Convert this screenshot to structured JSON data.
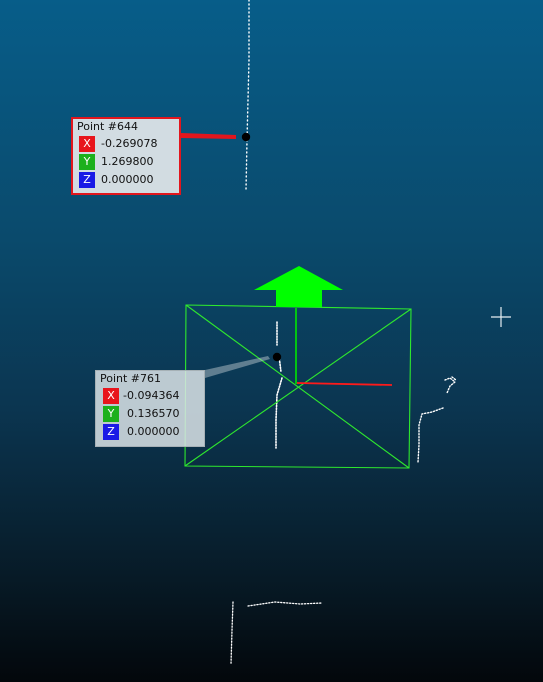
{
  "viewport": {
    "background_top": "#075d89",
    "background_bottom": "#03070b",
    "bounding_box_color": "#2ee82e",
    "arrow_color": "#00ff00",
    "axis_x_color": "#ff1a1a",
    "axis_y_color": "#00e600",
    "cursor_icon": "crosshair-icon"
  },
  "point_labels": [
    {
      "title": "Point #644",
      "selected": true,
      "x": "-0.269078",
      "y": "1.269800",
      "z": "0.000000"
    },
    {
      "title": "Point #761",
      "selected": false,
      "x": "-0.094364",
      "y": "0.136570",
      "z": "0.000000"
    }
  ],
  "axis_tags": {
    "x": "X",
    "y": "Y",
    "z": "Z"
  }
}
